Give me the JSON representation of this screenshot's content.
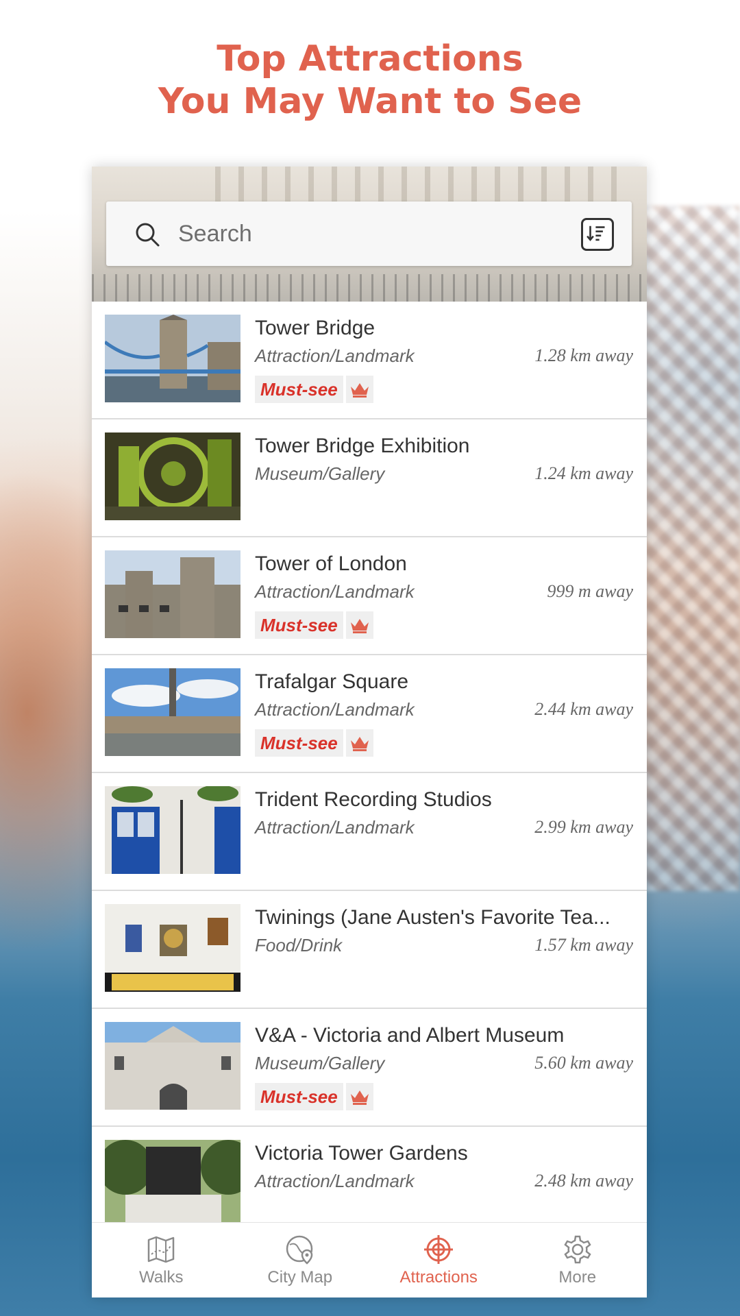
{
  "headline": {
    "line1": "Top Attractions",
    "line2": "You May Want to See"
  },
  "search": {
    "placeholder": "Search"
  },
  "colors": {
    "accent": "#e0624e",
    "must_see_text": "#d9322a",
    "text": "#333333",
    "muted": "#666666"
  },
  "attractions": [
    {
      "name": "Tower Bridge",
      "category": "Attraction/Landmark",
      "distance": "1.28 km away",
      "badge": "Must-see"
    },
    {
      "name": "Tower Bridge Exhibition",
      "category": "Museum/Gallery",
      "distance": "1.24 km away",
      "badge": ""
    },
    {
      "name": "Tower of London",
      "category": "Attraction/Landmark",
      "distance": "999 m away",
      "badge": "Must-see"
    },
    {
      "name": "Trafalgar Square",
      "category": "Attraction/Landmark",
      "distance": "2.44 km away",
      "badge": "Must-see"
    },
    {
      "name": "Trident Recording Studios",
      "category": "Attraction/Landmark",
      "distance": "2.99 km away",
      "badge": ""
    },
    {
      "name": "Twinings (Jane Austen's Favorite Tea...",
      "category": "Food/Drink",
      "distance": "1.57 km away",
      "badge": ""
    },
    {
      "name": "V&A - Victoria and Albert Museum",
      "category": "Museum/Gallery",
      "distance": "5.60 km away",
      "badge": "Must-see"
    },
    {
      "name": "Victoria Tower Gardens",
      "category": "Attraction/Landmark",
      "distance": "2.48 km away",
      "badge": ""
    }
  ],
  "tabs": [
    {
      "label": "Walks",
      "icon": "map-icon",
      "active": false
    },
    {
      "label": "City Map",
      "icon": "globe-pin-icon",
      "active": false
    },
    {
      "label": "Attractions",
      "icon": "target-icon",
      "active": true
    },
    {
      "label": "More",
      "icon": "gear-icon",
      "active": false
    }
  ]
}
